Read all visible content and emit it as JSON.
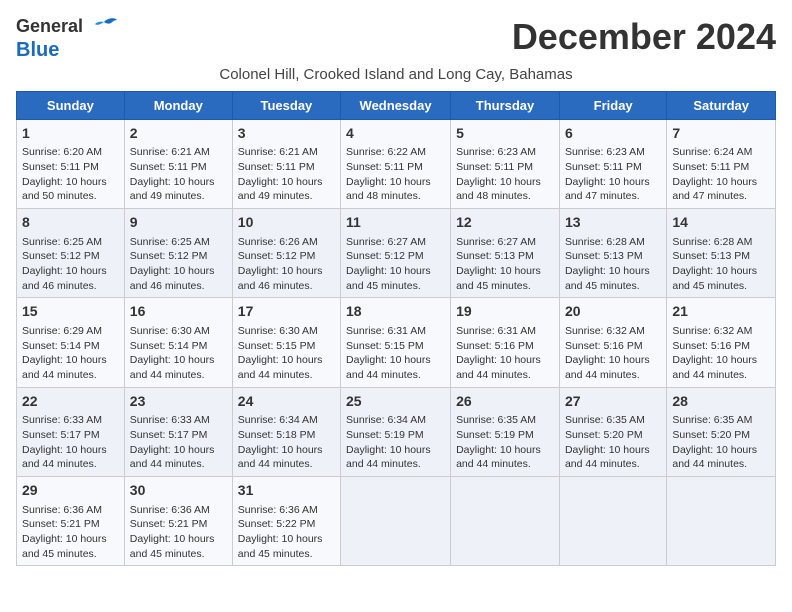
{
  "header": {
    "logo_general": "General",
    "logo_blue": "Blue",
    "month_title": "December 2024",
    "subtitle": "Colonel Hill, Crooked Island and Long Cay, Bahamas"
  },
  "weekdays": [
    "Sunday",
    "Monday",
    "Tuesday",
    "Wednesday",
    "Thursday",
    "Friday",
    "Saturday"
  ],
  "weeks": [
    [
      {
        "day": "1",
        "sunrise": "Sunrise: 6:20 AM",
        "sunset": "Sunset: 5:11 PM",
        "daylight": "Daylight: 10 hours and 50 minutes."
      },
      {
        "day": "2",
        "sunrise": "Sunrise: 6:21 AM",
        "sunset": "Sunset: 5:11 PM",
        "daylight": "Daylight: 10 hours and 49 minutes."
      },
      {
        "day": "3",
        "sunrise": "Sunrise: 6:21 AM",
        "sunset": "Sunset: 5:11 PM",
        "daylight": "Daylight: 10 hours and 49 minutes."
      },
      {
        "day": "4",
        "sunrise": "Sunrise: 6:22 AM",
        "sunset": "Sunset: 5:11 PM",
        "daylight": "Daylight: 10 hours and 48 minutes."
      },
      {
        "day": "5",
        "sunrise": "Sunrise: 6:23 AM",
        "sunset": "Sunset: 5:11 PM",
        "daylight": "Daylight: 10 hours and 48 minutes."
      },
      {
        "day": "6",
        "sunrise": "Sunrise: 6:23 AM",
        "sunset": "Sunset: 5:11 PM",
        "daylight": "Daylight: 10 hours and 47 minutes."
      },
      {
        "day": "7",
        "sunrise": "Sunrise: 6:24 AM",
        "sunset": "Sunset: 5:11 PM",
        "daylight": "Daylight: 10 hours and 47 minutes."
      }
    ],
    [
      {
        "day": "8",
        "sunrise": "Sunrise: 6:25 AM",
        "sunset": "Sunset: 5:12 PM",
        "daylight": "Daylight: 10 hours and 46 minutes."
      },
      {
        "day": "9",
        "sunrise": "Sunrise: 6:25 AM",
        "sunset": "Sunset: 5:12 PM",
        "daylight": "Daylight: 10 hours and 46 minutes."
      },
      {
        "day": "10",
        "sunrise": "Sunrise: 6:26 AM",
        "sunset": "Sunset: 5:12 PM",
        "daylight": "Daylight: 10 hours and 46 minutes."
      },
      {
        "day": "11",
        "sunrise": "Sunrise: 6:27 AM",
        "sunset": "Sunset: 5:12 PM",
        "daylight": "Daylight: 10 hours and 45 minutes."
      },
      {
        "day": "12",
        "sunrise": "Sunrise: 6:27 AM",
        "sunset": "Sunset: 5:13 PM",
        "daylight": "Daylight: 10 hours and 45 minutes."
      },
      {
        "day": "13",
        "sunrise": "Sunrise: 6:28 AM",
        "sunset": "Sunset: 5:13 PM",
        "daylight": "Daylight: 10 hours and 45 minutes."
      },
      {
        "day": "14",
        "sunrise": "Sunrise: 6:28 AM",
        "sunset": "Sunset: 5:13 PM",
        "daylight": "Daylight: 10 hours and 45 minutes."
      }
    ],
    [
      {
        "day": "15",
        "sunrise": "Sunrise: 6:29 AM",
        "sunset": "Sunset: 5:14 PM",
        "daylight": "Daylight: 10 hours and 44 minutes."
      },
      {
        "day": "16",
        "sunrise": "Sunrise: 6:30 AM",
        "sunset": "Sunset: 5:14 PM",
        "daylight": "Daylight: 10 hours and 44 minutes."
      },
      {
        "day": "17",
        "sunrise": "Sunrise: 6:30 AM",
        "sunset": "Sunset: 5:15 PM",
        "daylight": "Daylight: 10 hours and 44 minutes."
      },
      {
        "day": "18",
        "sunrise": "Sunrise: 6:31 AM",
        "sunset": "Sunset: 5:15 PM",
        "daylight": "Daylight: 10 hours and 44 minutes."
      },
      {
        "day": "19",
        "sunrise": "Sunrise: 6:31 AM",
        "sunset": "Sunset: 5:16 PM",
        "daylight": "Daylight: 10 hours and 44 minutes."
      },
      {
        "day": "20",
        "sunrise": "Sunrise: 6:32 AM",
        "sunset": "Sunset: 5:16 PM",
        "daylight": "Daylight: 10 hours and 44 minutes."
      },
      {
        "day": "21",
        "sunrise": "Sunrise: 6:32 AM",
        "sunset": "Sunset: 5:16 PM",
        "daylight": "Daylight: 10 hours and 44 minutes."
      }
    ],
    [
      {
        "day": "22",
        "sunrise": "Sunrise: 6:33 AM",
        "sunset": "Sunset: 5:17 PM",
        "daylight": "Daylight: 10 hours and 44 minutes."
      },
      {
        "day": "23",
        "sunrise": "Sunrise: 6:33 AM",
        "sunset": "Sunset: 5:17 PM",
        "daylight": "Daylight: 10 hours and 44 minutes."
      },
      {
        "day": "24",
        "sunrise": "Sunrise: 6:34 AM",
        "sunset": "Sunset: 5:18 PM",
        "daylight": "Daylight: 10 hours and 44 minutes."
      },
      {
        "day": "25",
        "sunrise": "Sunrise: 6:34 AM",
        "sunset": "Sunset: 5:19 PM",
        "daylight": "Daylight: 10 hours and 44 minutes."
      },
      {
        "day": "26",
        "sunrise": "Sunrise: 6:35 AM",
        "sunset": "Sunset: 5:19 PM",
        "daylight": "Daylight: 10 hours and 44 minutes."
      },
      {
        "day": "27",
        "sunrise": "Sunrise: 6:35 AM",
        "sunset": "Sunset: 5:20 PM",
        "daylight": "Daylight: 10 hours and 44 minutes."
      },
      {
        "day": "28",
        "sunrise": "Sunrise: 6:35 AM",
        "sunset": "Sunset: 5:20 PM",
        "daylight": "Daylight: 10 hours and 44 minutes."
      }
    ],
    [
      {
        "day": "29",
        "sunrise": "Sunrise: 6:36 AM",
        "sunset": "Sunset: 5:21 PM",
        "daylight": "Daylight: 10 hours and 45 minutes."
      },
      {
        "day": "30",
        "sunrise": "Sunrise: 6:36 AM",
        "sunset": "Sunset: 5:21 PM",
        "daylight": "Daylight: 10 hours and 45 minutes."
      },
      {
        "day": "31",
        "sunrise": "Sunrise: 6:36 AM",
        "sunset": "Sunset: 5:22 PM",
        "daylight": "Daylight: 10 hours and 45 minutes."
      },
      null,
      null,
      null,
      null
    ]
  ]
}
